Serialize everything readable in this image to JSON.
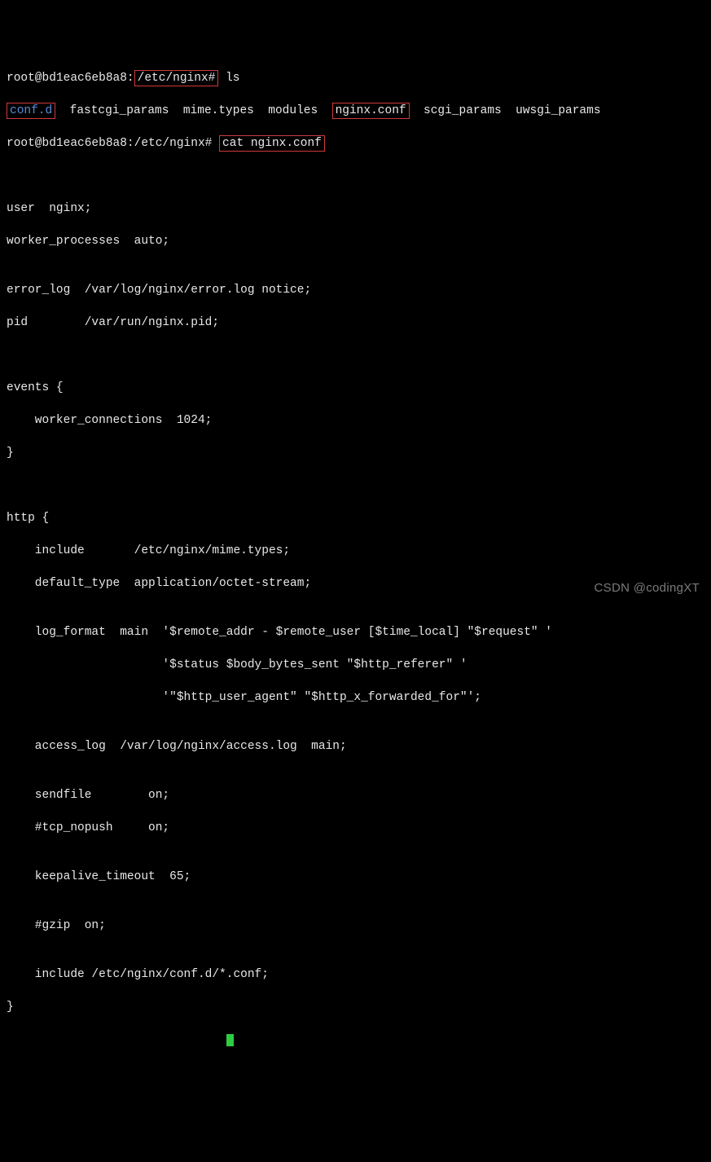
{
  "line1": {
    "prompt_prefix": "root@bd1eac6eb8a8:",
    "path_boxed": "/etc/nginx#",
    "cmd": "ls"
  },
  "ls": {
    "entry1": "conf.d",
    "gap1": "  ",
    "entry2": "fastcgi_params  mime.types  modules  ",
    "entry3": "nginx.conf",
    "gap2": "  ",
    "entry4": "scgi_params  uwsgi_params"
  },
  "line3": {
    "prompt": "root@bd1eac6eb8a8:/etc/nginx#",
    "cmd_boxed": "cat nginx.conf"
  },
  "conf": {
    "blank_a": "",
    "blank_b": "",
    "l1": "user  nginx;",
    "l2": "worker_processes  auto;",
    "blank_c": "",
    "l3": "error_log  /var/log/nginx/error.log notice;",
    "l4": "pid        /var/run/nginx.pid;",
    "blank_d": "",
    "blank_e": "",
    "l5": "events {",
    "l6": "    worker_connections  1024;",
    "l7": "}",
    "blank_f": "",
    "blank_g": "",
    "l8": "http {",
    "l9": "    include       /etc/nginx/mime.types;",
    "l10": "    default_type  application/octet-stream;",
    "blank_h": "",
    "l11": "    log_format  main  '$remote_addr - $remote_user [$time_local] \"$request\" '",
    "l12": "                      '$status $body_bytes_sent \"$http_referer\" '",
    "l13": "                      '\"$http_user_agent\" \"$http_x_forwarded_for\"';",
    "blank_i": "",
    "l14": "    access_log  /var/log/nginx/access.log  main;",
    "blank_j": "",
    "l15": "    sendfile        on;",
    "l16": "    #tcp_nopush     on;",
    "blank_k": "",
    "l17": "    keepalive_timeout  65;",
    "blank_l": "",
    "l18": "    #gzip  on;",
    "blank_m": "",
    "l19": "    include /etc/nginx/conf.d/*.conf;",
    "l20": "}"
  },
  "watermark": "CSDN @codingXT"
}
